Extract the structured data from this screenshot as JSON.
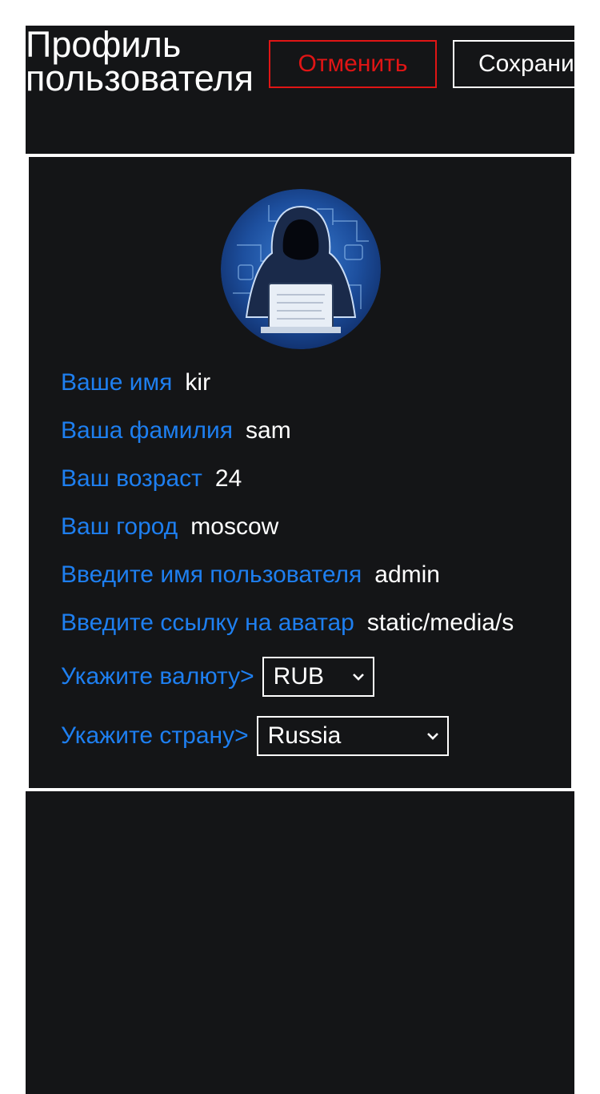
{
  "header": {
    "title": "Профиль пользователя",
    "cancel_label": "Отменить",
    "save_label": "Сохранить"
  },
  "profile": {
    "avatar_alt": "hacker-avatar",
    "fields": [
      {
        "label": "Ваше имя",
        "value": "kir"
      },
      {
        "label": "Ваша фамилия",
        "value": "sam"
      },
      {
        "label": "Ваш возраст",
        "value": "24"
      },
      {
        "label": "Ваш город",
        "value": "moscow"
      },
      {
        "label": "Введите имя пользователя",
        "value": "admin"
      },
      {
        "label": "Введите ссылку на аватар",
        "value": "static/media/s"
      }
    ],
    "currency": {
      "label": "Укажите валюту>",
      "selected": "RUB"
    },
    "country": {
      "label": "Укажите страну>",
      "selected": "Russia"
    }
  },
  "colors": {
    "background": "#141517",
    "accent": "#1e7ff0",
    "danger": "#e01515",
    "text": "#ffffff"
  }
}
